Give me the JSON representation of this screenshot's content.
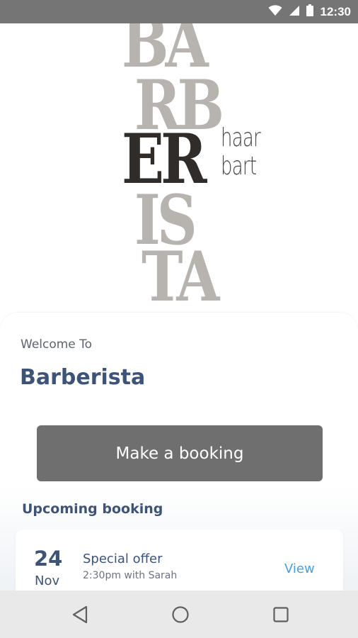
{
  "status_bar": {
    "time": "12:30",
    "icons": [
      "wifi-icon",
      "cellular-signal-icon",
      "battery-icon"
    ]
  },
  "logo": {
    "lines": [
      "BA",
      "RB",
      "ER",
      "IS",
      "TA"
    ],
    "side_text": [
      "haar",
      "bart"
    ],
    "colors": {
      "light": "#b7b4b0",
      "dark": "#2f2c2a"
    }
  },
  "welcome": {
    "greeting": "Welcome To",
    "business_name": "Barberista"
  },
  "actions": {
    "booking_button": "Make a booking"
  },
  "upcoming": {
    "heading": "Upcoming booking",
    "booking": {
      "day": "24",
      "month": "Nov",
      "title": "Special offer",
      "detail": "2:30pm with Sarah",
      "action": "View"
    }
  },
  "navigation": {
    "buttons": [
      "back-icon",
      "home-icon",
      "recents-icon"
    ]
  },
  "colors": {
    "accent": "#3d5478",
    "button": "#6f6f6f",
    "link": "#4a9fd8",
    "status_bar": "#757575"
  }
}
